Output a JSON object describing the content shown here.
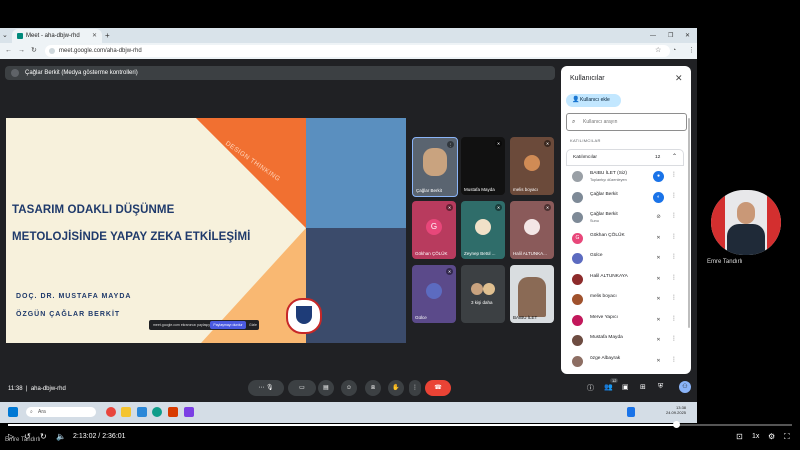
{
  "browser": {
    "tab_title": "Meet - aha-dbjw-rhd",
    "url": "meet.google.com/aha-dbjw-rhd"
  },
  "meet": {
    "presenter_label": "Çağlar Berkit (Medya gösterme kontrolleri)",
    "slide": {
      "title_line1": "TASARIM ODAKLI DÜŞÜNME",
      "title_line2": "METOLOJİSİNDE YAPAY ZEKA ETKİLEŞİMİ",
      "author1": "DOÇ. DR. MUSTAFA MAYDA",
      "author2": "ÖZGÜN ÇAĞLAR BERKİT",
      "rotated_text": "DESIGN THINKING",
      "notice_text": "meet.google.com ekranınızı paylaşıyor",
      "notice_button": "Paylaşmayı durdur",
      "notice_hide": "Gizle"
    },
    "tiles": [
      {
        "name": "Çağlar Berkit"
      },
      {
        "name": "Mustafa Mayda"
      },
      {
        "name": "melis boyacı"
      },
      {
        "name": "Gökhan ÇÖLÜK",
        "initial": "G"
      },
      {
        "name": "Zeynep Betül ..."
      },
      {
        "name": "Halil ALTUNKA..."
      },
      {
        "name": "Gülce"
      },
      {
        "name": "3 kişi daha"
      },
      {
        "name": "BAIBU İLET"
      }
    ],
    "meeting_time": "11:38",
    "meeting_code": "aha-dbjw-rhd",
    "participant_badge": "12"
  },
  "panel": {
    "title": "Kullanıcılar",
    "add_button": "Kullanıcı ekle",
    "search_placeholder": "Kullanıcı arayın",
    "section_label": "KATILIMCILAR",
    "group_label": "Katılımcılar",
    "group_count": "12",
    "people": [
      {
        "name": "BAIBU İLET (Siz)",
        "sub": "Toplantıyı düzenleyen",
        "color": "#9aa0a6",
        "initial": ""
      },
      {
        "name": "Çağlar Berkit",
        "sub": "",
        "color": "#7e8a97",
        "initial": ""
      },
      {
        "name": "Çağlar Berkit",
        "sub": "Sunu",
        "color": "#7e8a97",
        "initial": ""
      },
      {
        "name": "Gökhan ÇÖLÜK",
        "sub": "",
        "color": "#e8477a",
        "initial": "G"
      },
      {
        "name": "Gülce",
        "sub": "",
        "color": "#5c6bc0",
        "initial": ""
      },
      {
        "name": "Halil ALTUNKAYA",
        "sub": "",
        "color": "#8d2b2b",
        "initial": ""
      },
      {
        "name": "melis boyacı",
        "sub": "",
        "color": "#a0522d",
        "initial": ""
      },
      {
        "name": "Merve Yapıcı",
        "sub": "",
        "color": "#c2185b",
        "initial": ""
      },
      {
        "name": "Mustafa Mayda",
        "sub": "",
        "color": "#6d4c41",
        "initial": ""
      },
      {
        "name": "özge Albayrak",
        "sub": "",
        "color": "#8d6e63",
        "initial": ""
      }
    ]
  },
  "side_cam": {
    "name": "Emre Tandırlı"
  },
  "taskbar": {
    "search_label": "Ara",
    "time": "13:38",
    "date": "24.09.2025"
  },
  "player": {
    "time_display": "2:13:02 / 2:36:01",
    "speed": "1x",
    "progress_fraction": 0.852,
    "watermark": "Emre Tandırlı"
  },
  "colors": {
    "slide_bg": "#f7f1dc",
    "slide_orange": "#f2783a",
    "slide_peach": "#f9b872",
    "slide_blue": "#5a8fbf",
    "slide_navy": "#3b4b6b",
    "title_navy": "#1f3a6b",
    "end_call_red": "#ea4335"
  }
}
